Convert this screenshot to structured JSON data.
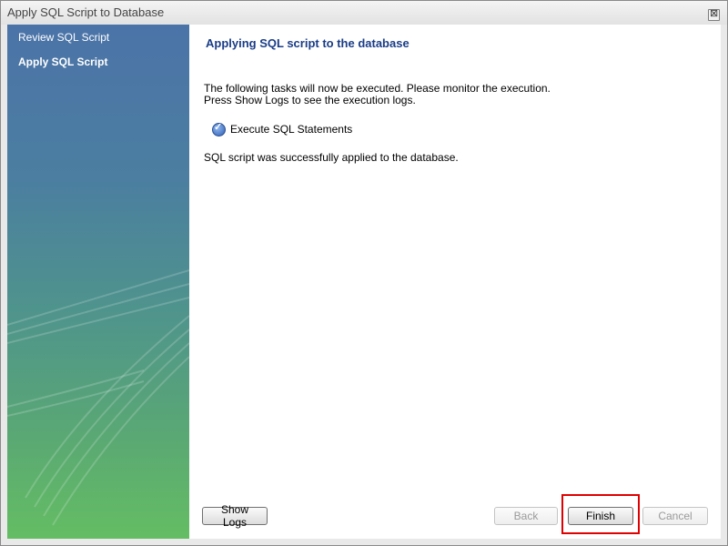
{
  "window": {
    "title": "Apply SQL Script to Database",
    "close_glyph": "⊠"
  },
  "sidebar": {
    "items": [
      {
        "label": "Review SQL Script",
        "active": false
      },
      {
        "label": "Apply SQL Script",
        "active": true
      }
    ]
  },
  "main": {
    "heading": "Applying SQL script to the database",
    "description_line1": "The following tasks will now be executed. Please monitor the execution.",
    "description_line2": "Press Show Logs to see the execution logs.",
    "tasks": [
      {
        "label": "Execute SQL Statements",
        "status_icon": "checkmark-icon",
        "icon_glyph": "✓"
      }
    ],
    "status_message": "SQL script was successfully applied to the database."
  },
  "buttons": {
    "show_logs": "Show Logs",
    "back": "Back",
    "finish": "Finish",
    "cancel": "Cancel"
  },
  "colors": {
    "heading": "#1a3d87",
    "highlight": "#e00000"
  }
}
